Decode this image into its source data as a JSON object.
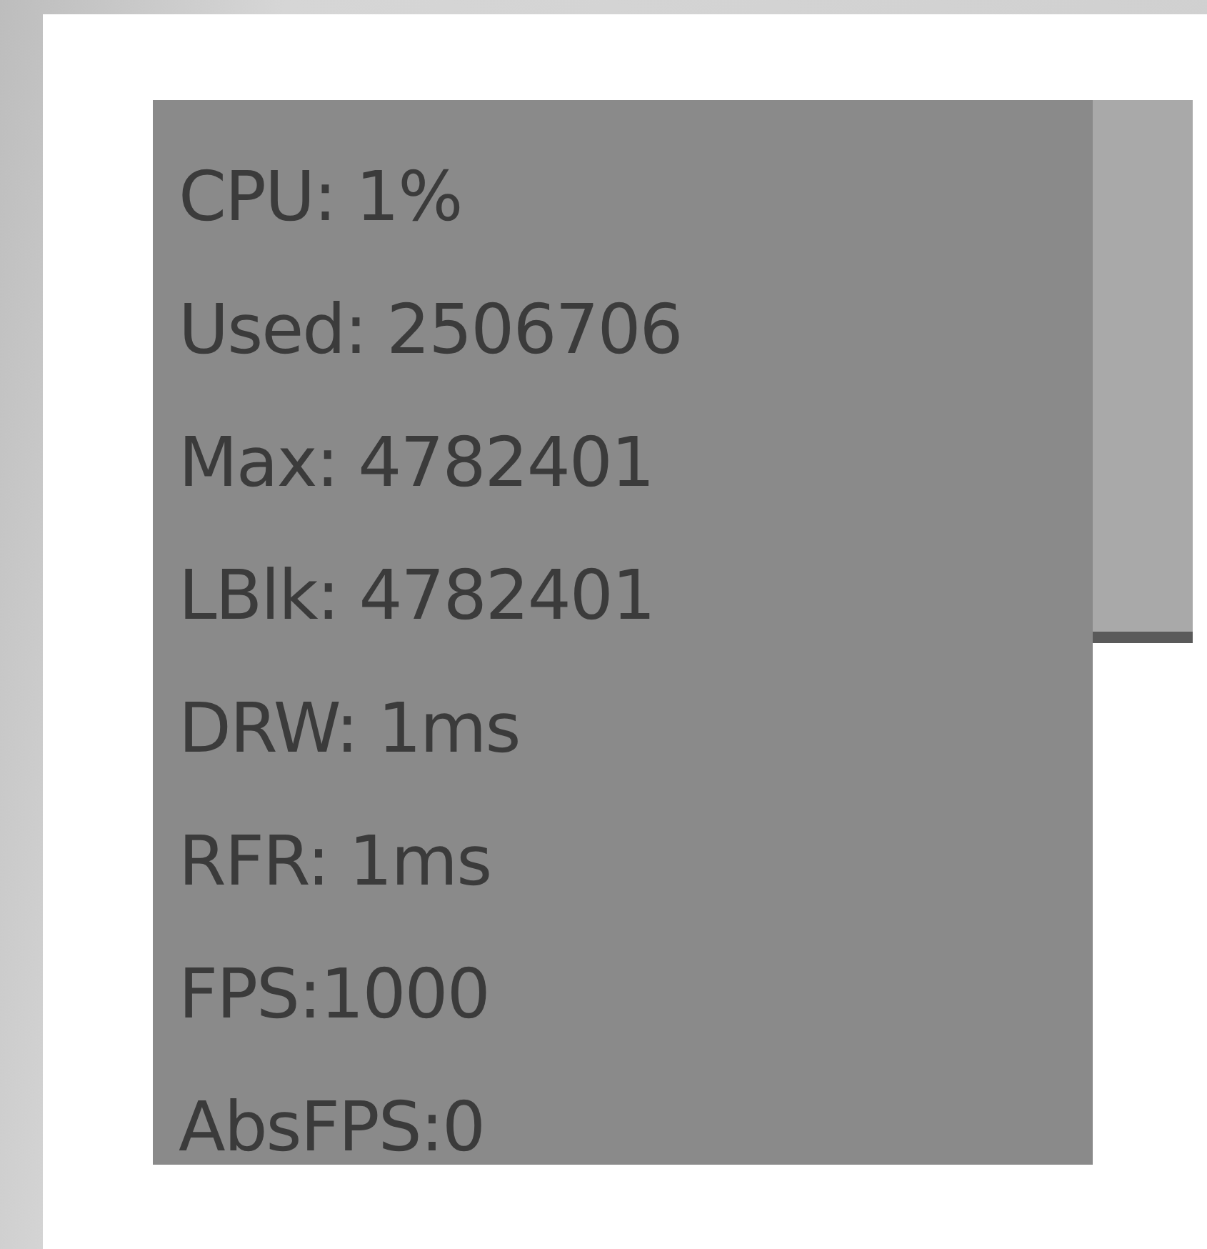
{
  "stats": [
    "CPU: 1%",
    "Used: 2506706",
    "Max: 4782401",
    "LBlk: 4782401",
    "DRW: 1ms",
    "RFR: 1ms",
    "FPS:1000",
    "AbsFPS:0"
  ]
}
